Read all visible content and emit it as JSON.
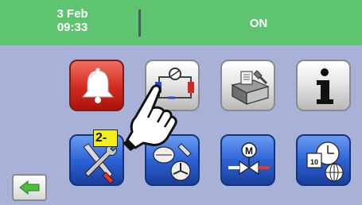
{
  "header": {
    "date": "3 Feb",
    "time": "09:33",
    "status": "ON"
  },
  "callout": {
    "label": "2-"
  },
  "icons": {
    "row1": [
      "alarm-bell-icon",
      "refrigeration-circuit-icon",
      "service-toolbox-icon",
      "info-icon"
    ],
    "row2": [
      "tools-settings-icon",
      "compressor-fan-icon",
      "motor-valve-icon",
      "calendar-clock-network-icon"
    ],
    "back": "back-arrow-icon",
    "pointer": "pointing-hand-icon"
  },
  "colors": {
    "header": "#5fc470",
    "screen": "#a8b2d8",
    "alarm": "#d22a1f",
    "blue_tile": "#2d62d8",
    "callout": "#f4ee1b"
  }
}
